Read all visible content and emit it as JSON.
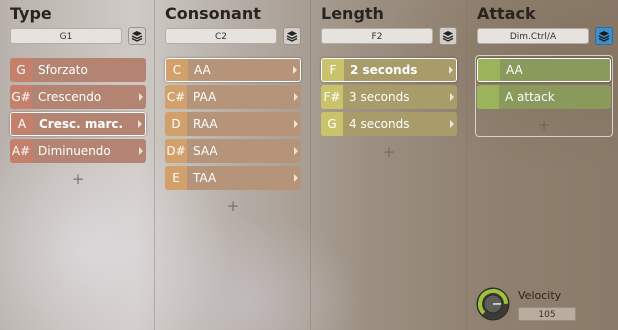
{
  "columns": [
    {
      "title": "Type",
      "selector": "G1",
      "layer_active": false,
      "items": [
        {
          "key": "G",
          "label": "Sforzato",
          "arrow": false,
          "selected": false,
          "bold": false
        },
        {
          "key": "G#",
          "label": "Crescendo",
          "arrow": true,
          "selected": false,
          "bold": false
        },
        {
          "key": "A",
          "label": "Cresc. marc.",
          "arrow": true,
          "selected": true,
          "bold": true
        },
        {
          "key": "A#",
          "label": "Diminuendo",
          "arrow": true,
          "selected": false,
          "bold": false
        }
      ],
      "add": "+"
    },
    {
      "title": "Consonant",
      "selector": "C2",
      "layer_active": false,
      "items": [
        {
          "key": "C",
          "label": "AA",
          "arrow": true,
          "selected": true,
          "bold": false
        },
        {
          "key": "C#",
          "label": "PAA",
          "arrow": true,
          "selected": false,
          "bold": false
        },
        {
          "key": "D",
          "label": "RAA",
          "arrow": true,
          "selected": false,
          "bold": false
        },
        {
          "key": "D#",
          "label": "SAA",
          "arrow": true,
          "selected": false,
          "bold": false
        },
        {
          "key": "E",
          "label": "TAA",
          "arrow": true,
          "selected": false,
          "bold": false
        }
      ],
      "add": "+"
    },
    {
      "title": "Length",
      "selector": "F2",
      "layer_active": false,
      "items": [
        {
          "key": "F",
          "label": "2 seconds",
          "arrow": true,
          "selected": true,
          "bold": true
        },
        {
          "key": "F#",
          "label": "3 seconds",
          "arrow": true,
          "selected": false,
          "bold": false
        },
        {
          "key": "G",
          "label": "4 seconds",
          "arrow": true,
          "selected": false,
          "bold": false
        }
      ],
      "add": "+"
    },
    {
      "title": "Attack",
      "selector": "Dim.Ctrl/A",
      "layer_active": true,
      "items": [
        {
          "key": "",
          "label": "AA",
          "arrow": false,
          "selected": true,
          "bold": false
        },
        {
          "key": "",
          "label": "A attack",
          "arrow": false,
          "selected": false,
          "bold": false
        }
      ],
      "add": "+"
    }
  ],
  "velocity": {
    "label": "Velocity",
    "value": "105",
    "level": 0.83
  },
  "colors": {
    "type_key": "#c4806b",
    "type_item": "#b38472",
    "consonant_key": "#d2a06a",
    "consonant_item": "#b59479",
    "length_key": "#c9c46b",
    "length_item": "#a89c6a",
    "attack_key": "#9bb35a",
    "attack_item": "#8a9a5d",
    "knob_accent": "#9fc23a"
  },
  "icons": {
    "layers": "layers-icon",
    "arrow": "chevron-right-icon",
    "add": "plus-icon",
    "knob": "velocity-knob"
  }
}
